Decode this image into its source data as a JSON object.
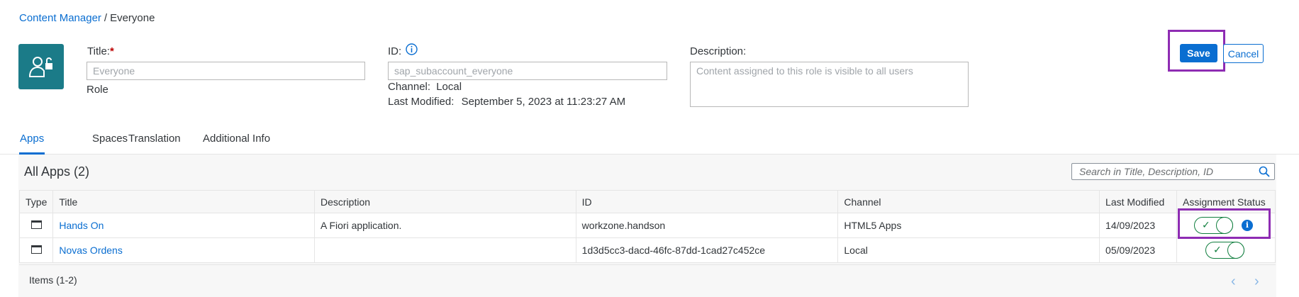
{
  "breadcrumb": {
    "link": "Content Manager",
    "separator": "/",
    "current": "Everyone"
  },
  "header": {
    "title_label": "Title:",
    "required_mark": "*",
    "title_value": "Everyone",
    "type_label": "Role",
    "id_label": "ID:",
    "id_value": "sap_subaccount_everyone",
    "channel_label": "Channel:",
    "channel_value": "Local",
    "modified_label": "Last Modified:",
    "modified_value": "September 5, 2023 at 11:23:27 AM",
    "description_label": "Description:",
    "description_placeholder": "Content assigned to this role is visible to all users"
  },
  "actions": {
    "save": "Save",
    "cancel": "Cancel"
  },
  "tabs": [
    {
      "label": "Apps",
      "active": true
    },
    {
      "label": "Spaces",
      "active": false
    },
    {
      "label": "Translation",
      "active": false
    },
    {
      "label": "Additional Info",
      "active": false
    }
  ],
  "apps": {
    "title": "All Apps (2)",
    "search_placeholder": "Search in Title, Description, ID",
    "columns": [
      "Type",
      "Title",
      "Description",
      "ID",
      "Channel",
      "Last Modified",
      "Assignment Status"
    ],
    "rows": [
      {
        "title": "Hands On",
        "description": "A Fiori application.",
        "id": "workzone.handson",
        "channel": "HTML5 Apps",
        "modified": "14/09/2023",
        "assigned": true,
        "info": "i"
      },
      {
        "title": "Novas Ordens",
        "description": "",
        "id": "1d3d5cc3-dacd-46fc-87dd-1cad27c452ce",
        "channel": "Local",
        "modified": "05/09/2023",
        "assigned": true
      }
    ],
    "footer": "Items (1-2)"
  },
  "colors": {
    "accent": "#0a6ed1",
    "role_tile": "#1b7b88",
    "highlight": "#8e2cb3",
    "positive": "#107e3e"
  },
  "icons": {
    "role": "role-lock-icon",
    "info": "info-icon",
    "search": "search-icon",
    "type": "app-window-icon",
    "toggle_check": "✓",
    "prev": "‹",
    "next": "›"
  }
}
